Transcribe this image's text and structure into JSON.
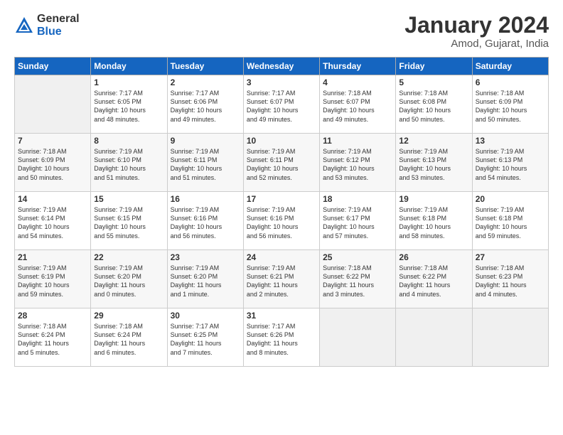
{
  "logo": {
    "general": "General",
    "blue": "Blue"
  },
  "title": {
    "month": "January 2024",
    "location": "Amod, Gujarat, India"
  },
  "headers": [
    "Sunday",
    "Monday",
    "Tuesday",
    "Wednesday",
    "Thursday",
    "Friday",
    "Saturday"
  ],
  "weeks": [
    [
      {
        "day": "",
        "info": ""
      },
      {
        "day": "1",
        "info": "Sunrise: 7:17 AM\nSunset: 6:05 PM\nDaylight: 10 hours\nand 48 minutes."
      },
      {
        "day": "2",
        "info": "Sunrise: 7:17 AM\nSunset: 6:06 PM\nDaylight: 10 hours\nand 49 minutes."
      },
      {
        "day": "3",
        "info": "Sunrise: 7:17 AM\nSunset: 6:07 PM\nDaylight: 10 hours\nand 49 minutes."
      },
      {
        "day": "4",
        "info": "Sunrise: 7:18 AM\nSunset: 6:07 PM\nDaylight: 10 hours\nand 49 minutes."
      },
      {
        "day": "5",
        "info": "Sunrise: 7:18 AM\nSunset: 6:08 PM\nDaylight: 10 hours\nand 50 minutes."
      },
      {
        "day": "6",
        "info": "Sunrise: 7:18 AM\nSunset: 6:09 PM\nDaylight: 10 hours\nand 50 minutes."
      }
    ],
    [
      {
        "day": "7",
        "info": "Sunrise: 7:18 AM\nSunset: 6:09 PM\nDaylight: 10 hours\nand 50 minutes."
      },
      {
        "day": "8",
        "info": "Sunrise: 7:19 AM\nSunset: 6:10 PM\nDaylight: 10 hours\nand 51 minutes."
      },
      {
        "day": "9",
        "info": "Sunrise: 7:19 AM\nSunset: 6:11 PM\nDaylight: 10 hours\nand 51 minutes."
      },
      {
        "day": "10",
        "info": "Sunrise: 7:19 AM\nSunset: 6:11 PM\nDaylight: 10 hours\nand 52 minutes."
      },
      {
        "day": "11",
        "info": "Sunrise: 7:19 AM\nSunset: 6:12 PM\nDaylight: 10 hours\nand 53 minutes."
      },
      {
        "day": "12",
        "info": "Sunrise: 7:19 AM\nSunset: 6:13 PM\nDaylight: 10 hours\nand 53 minutes."
      },
      {
        "day": "13",
        "info": "Sunrise: 7:19 AM\nSunset: 6:13 PM\nDaylight: 10 hours\nand 54 minutes."
      }
    ],
    [
      {
        "day": "14",
        "info": "Sunrise: 7:19 AM\nSunset: 6:14 PM\nDaylight: 10 hours\nand 54 minutes."
      },
      {
        "day": "15",
        "info": "Sunrise: 7:19 AM\nSunset: 6:15 PM\nDaylight: 10 hours\nand 55 minutes."
      },
      {
        "day": "16",
        "info": "Sunrise: 7:19 AM\nSunset: 6:16 PM\nDaylight: 10 hours\nand 56 minutes."
      },
      {
        "day": "17",
        "info": "Sunrise: 7:19 AM\nSunset: 6:16 PM\nDaylight: 10 hours\nand 56 minutes."
      },
      {
        "day": "18",
        "info": "Sunrise: 7:19 AM\nSunset: 6:17 PM\nDaylight: 10 hours\nand 57 minutes."
      },
      {
        "day": "19",
        "info": "Sunrise: 7:19 AM\nSunset: 6:18 PM\nDaylight: 10 hours\nand 58 minutes."
      },
      {
        "day": "20",
        "info": "Sunrise: 7:19 AM\nSunset: 6:18 PM\nDaylight: 10 hours\nand 59 minutes."
      }
    ],
    [
      {
        "day": "21",
        "info": "Sunrise: 7:19 AM\nSunset: 6:19 PM\nDaylight: 10 hours\nand 59 minutes."
      },
      {
        "day": "22",
        "info": "Sunrise: 7:19 AM\nSunset: 6:20 PM\nDaylight: 11 hours\nand 0 minutes."
      },
      {
        "day": "23",
        "info": "Sunrise: 7:19 AM\nSunset: 6:20 PM\nDaylight: 11 hours\nand 1 minute."
      },
      {
        "day": "24",
        "info": "Sunrise: 7:19 AM\nSunset: 6:21 PM\nDaylight: 11 hours\nand 2 minutes."
      },
      {
        "day": "25",
        "info": "Sunrise: 7:18 AM\nSunset: 6:22 PM\nDaylight: 11 hours\nand 3 minutes."
      },
      {
        "day": "26",
        "info": "Sunrise: 7:18 AM\nSunset: 6:22 PM\nDaylight: 11 hours\nand 4 minutes."
      },
      {
        "day": "27",
        "info": "Sunrise: 7:18 AM\nSunset: 6:23 PM\nDaylight: 11 hours\nand 4 minutes."
      }
    ],
    [
      {
        "day": "28",
        "info": "Sunrise: 7:18 AM\nSunset: 6:24 PM\nDaylight: 11 hours\nand 5 minutes."
      },
      {
        "day": "29",
        "info": "Sunrise: 7:18 AM\nSunset: 6:24 PM\nDaylight: 11 hours\nand 6 minutes."
      },
      {
        "day": "30",
        "info": "Sunrise: 7:17 AM\nSunset: 6:25 PM\nDaylight: 11 hours\nand 7 minutes."
      },
      {
        "day": "31",
        "info": "Sunrise: 7:17 AM\nSunset: 6:26 PM\nDaylight: 11 hours\nand 8 minutes."
      },
      {
        "day": "",
        "info": ""
      },
      {
        "day": "",
        "info": ""
      },
      {
        "day": "",
        "info": ""
      }
    ]
  ]
}
